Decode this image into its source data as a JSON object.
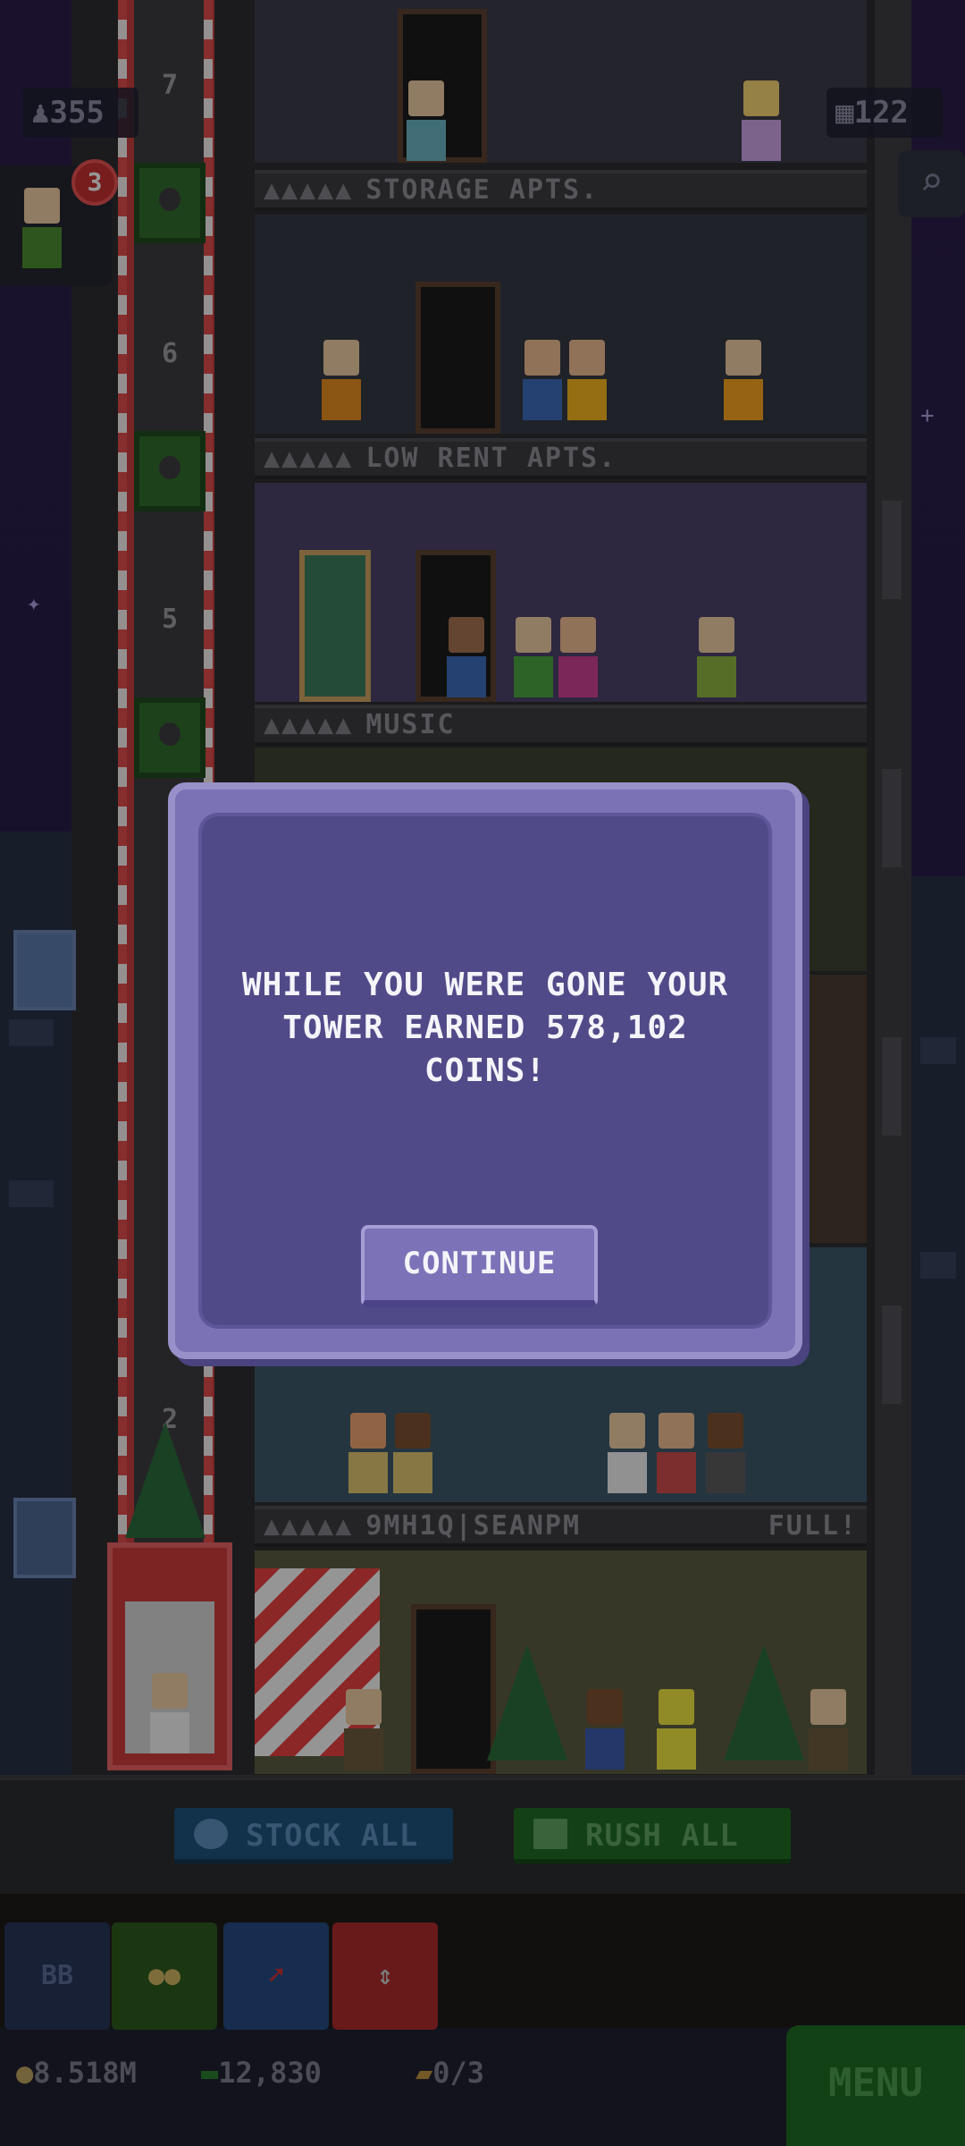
{
  "hud": {
    "population": "355",
    "floor_count": "122",
    "visitor_badge": "3"
  },
  "floors": [
    {
      "number": "7",
      "name": "STORAGE APTS.",
      "status": ""
    },
    {
      "number": "6",
      "name": "LOW RENT APTS.",
      "status": ""
    },
    {
      "number": "5",
      "name": "MUSIC",
      "status": ""
    },
    {
      "number": "2",
      "name": "9MH1Q|SEANPM",
      "status": "FULL!"
    }
  ],
  "floor_rating_dots": "▲▲▲▲▲",
  "modal": {
    "message": "WHILE YOU WERE GONE YOUR TOWER EARNED 578,102 COINS!",
    "continue_label": "CONTINUE"
  },
  "actions": {
    "stock_all": "STOCK ALL",
    "rush_all": "RUSH ALL"
  },
  "toolbar": {
    "bb_label": "BB"
  },
  "status_bar": {
    "coins": "8.518M",
    "bux": "12,830",
    "tickets": "0/3",
    "menu_label": "MENU"
  },
  "colors": {
    "modal_bg": "#514a88",
    "modal_border": "#7b72b6",
    "stock_blue": "#1e4f7a",
    "rush_green": "#1f6a22",
    "menu_green": "#1e6a25"
  },
  "icons": [
    "person-icon",
    "building-icon",
    "search-icon",
    "clock-icon",
    "cash-icon",
    "coin-icon",
    "ticket-icon",
    "coins-stack-icon",
    "pointer-icon",
    "elevator-icon"
  ]
}
